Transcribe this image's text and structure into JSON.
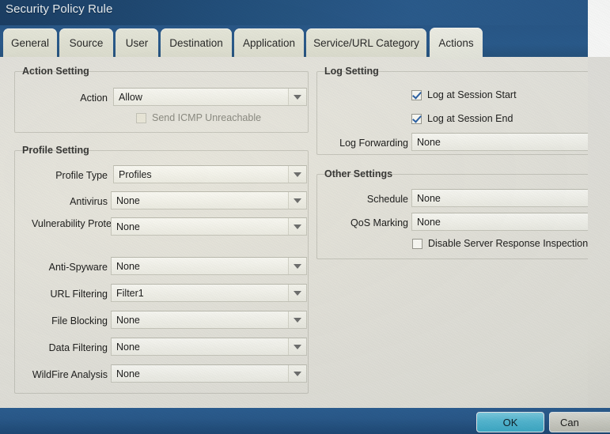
{
  "window": {
    "title": "Security Policy Rule"
  },
  "tabs": [
    {
      "label": "General",
      "active": false
    },
    {
      "label": "Source",
      "active": false
    },
    {
      "label": "User",
      "active": false
    },
    {
      "label": "Destination",
      "active": false
    },
    {
      "label": "Application",
      "active": false
    },
    {
      "label": "Service/URL Category",
      "active": false
    },
    {
      "label": "Actions",
      "active": true
    }
  ],
  "action_setting": {
    "title": "Action Setting",
    "action": {
      "label": "Action",
      "value": "Allow"
    },
    "send_icmp_unreachable": {
      "label": "Send ICMP Unreachable",
      "checked": false,
      "disabled": true
    }
  },
  "profile_setting": {
    "title": "Profile Setting",
    "rows": [
      {
        "label": "Profile Type",
        "value": "Profiles"
      },
      {
        "label": "Antivirus",
        "value": "None"
      },
      {
        "label": "Vulnerability Protection",
        "value": "None"
      },
      {
        "label": "Anti-Spyware",
        "value": "None"
      },
      {
        "label": "URL Filtering",
        "value": "Filter1"
      },
      {
        "label": "File Blocking",
        "value": "None"
      },
      {
        "label": "Data Filtering",
        "value": "None"
      },
      {
        "label": "WildFire Analysis",
        "value": "None"
      }
    ]
  },
  "log_setting": {
    "title": "Log Setting",
    "log_at_session_start": {
      "label": "Log at Session Start",
      "checked": true
    },
    "log_at_session_end": {
      "label": "Log at Session End",
      "checked": true
    },
    "log_forwarding": {
      "label": "Log Forwarding",
      "value": "None"
    }
  },
  "other_settings": {
    "title": "Other Settings",
    "schedule": {
      "label": "Schedule",
      "value": "None"
    },
    "qos_marking": {
      "label": "QoS Marking",
      "value": "None"
    },
    "disable_server_response_inspection": {
      "label": "Disable Server Response Inspection",
      "checked": false
    }
  },
  "footer": {
    "ok_label": "OK",
    "cancel_label": "Can"
  },
  "colors": {
    "title_bar": "#22507e",
    "tab_strip": "#2a5c8f",
    "panel": "#e7e6e1",
    "ok_button": "#56bcd8",
    "checkmark": "#2d63a8"
  }
}
